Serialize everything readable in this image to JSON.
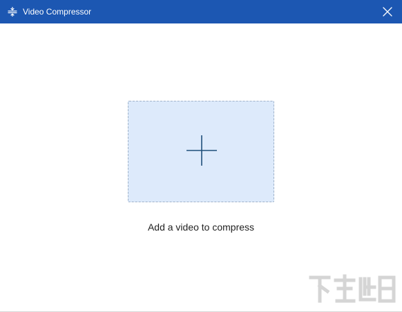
{
  "window": {
    "title": "Video Compressor",
    "icon": "compress-icon",
    "close_icon": "close-icon",
    "accent_color": "#1c57b2"
  },
  "main": {
    "drop_zone_icon": "plus-icon",
    "drop_zone_color": "#ddeafb",
    "add_label": "Add a video to compress"
  }
}
